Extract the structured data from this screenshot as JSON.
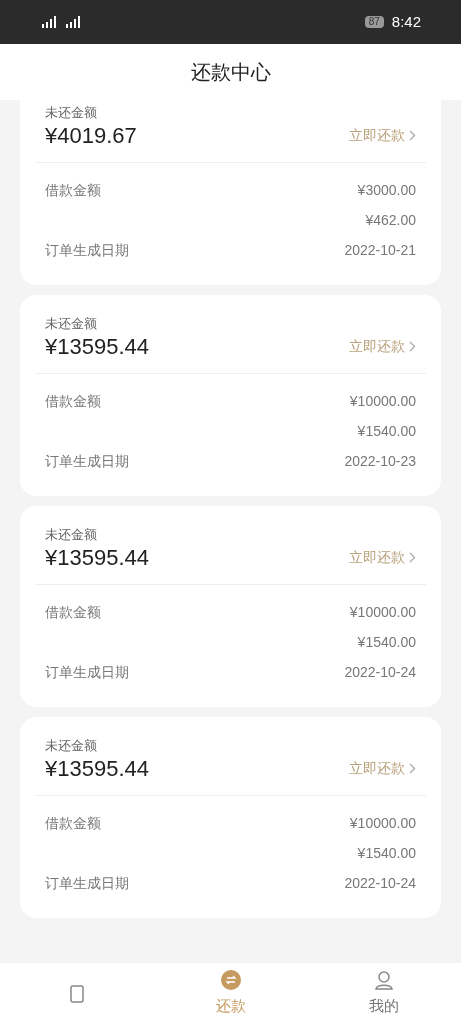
{
  "status_bar": {
    "time": "8:42",
    "battery": "87"
  },
  "header": {
    "title": "还款中心"
  },
  "orders": [
    {
      "outstanding_label": "未还金额",
      "outstanding": "¥4019.67",
      "pay_link": "立即还款",
      "rows": [
        {
          "label": "借款金额",
          "value": "¥3000.00"
        },
        {
          "value": "¥462.00"
        },
        {
          "label": "订单生成日期",
          "value": "2022-10-21"
        }
      ]
    },
    {
      "outstanding_label": "未还金额",
      "outstanding": "¥13595.44",
      "pay_link": "立即还款",
      "rows": [
        {
          "label": "借款金额",
          "value": "¥10000.00"
        },
        {
          "value": "¥1540.00"
        },
        {
          "label": "订单生成日期",
          "value": "2022-10-23"
        }
      ]
    },
    {
      "outstanding_label": "未还金额",
      "outstanding": "¥13595.44",
      "pay_link": "立即还款",
      "rows": [
        {
          "label": "借款金额",
          "value": "¥10000.00"
        },
        {
          "value": "¥1540.00"
        },
        {
          "label": "订单生成日期",
          "value": "2022-10-24"
        }
      ]
    },
    {
      "outstanding_label": "未还金额",
      "outstanding": "¥13595.44",
      "pay_link": "立即还款",
      "rows": [
        {
          "label": "借款金额",
          "value": "¥10000.00"
        },
        {
          "value": "¥1540.00"
        },
        {
          "label": "订单生成日期",
          "value": "2022-10-24"
        }
      ]
    }
  ],
  "tab_bar": [
    {
      "kind": "loan",
      "selected": false
    },
    {
      "kind": "repay",
      "label": "还款",
      "selected": true
    },
    {
      "kind": "me",
      "label": "我的",
      "selected": false
    }
  ]
}
